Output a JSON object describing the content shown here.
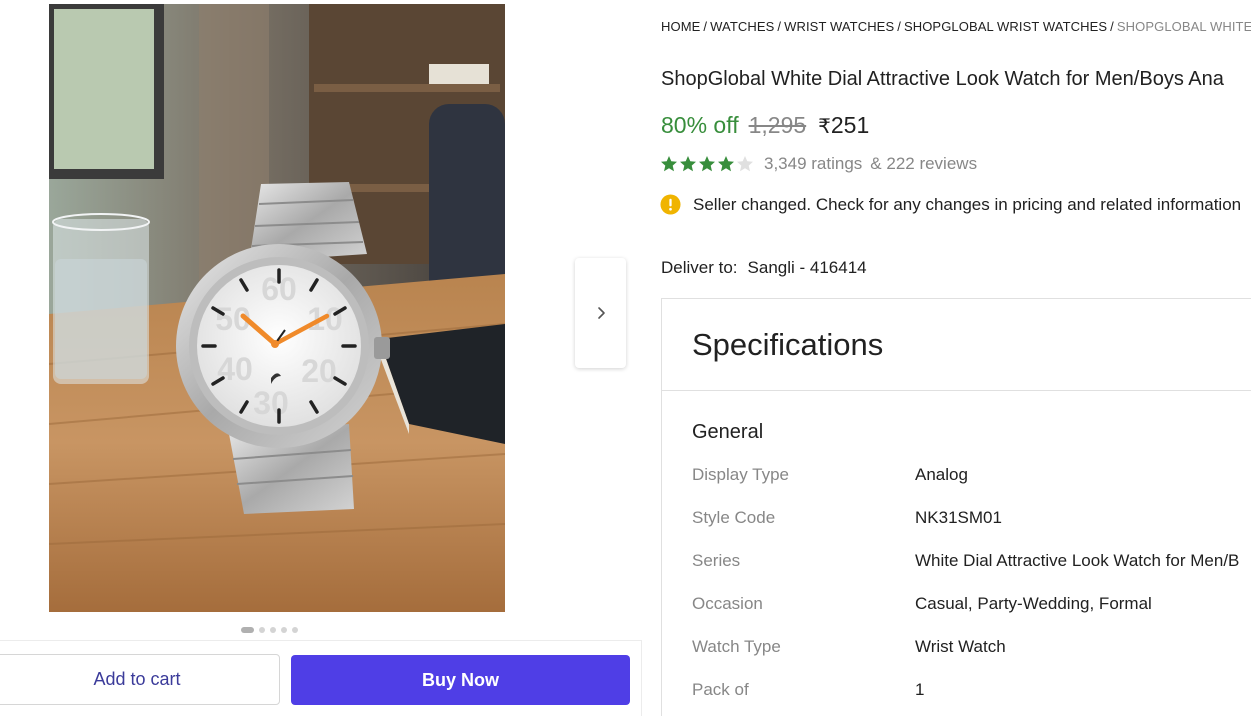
{
  "breadcrumb": [
    {
      "label": "HOME"
    },
    {
      "label": "WATCHES"
    },
    {
      "label": "WRIST WATCHES"
    },
    {
      "label": "SHOPGLOBAL WRIST WATCHES"
    },
    {
      "label": "SHOPGLOBAL WHITE DIA"
    }
  ],
  "product": {
    "title": "ShopGlobal White Dial Attractive Look Watch for Men/Boys Ana",
    "discount": "80% off",
    "mrp": "1,295",
    "currency": "₹",
    "price": "251",
    "rating_stars": 4,
    "ratings": "3,349 ratings",
    "reviews": "& 222 reviews"
  },
  "notice": {
    "text": "Seller changed. Check for any changes in pricing and related information"
  },
  "delivery": {
    "label": "Deliver to:",
    "location": "Sangli - 416414"
  },
  "gallery": {
    "image_count": 5,
    "active_index": 0
  },
  "actions": {
    "add_to_cart": "Add to cart",
    "buy_now": "Buy Now"
  },
  "specifications": {
    "title": "Specifications",
    "group": "General",
    "rows": [
      {
        "key": "Display Type",
        "value": "Analog"
      },
      {
        "key": "Style Code",
        "value": "NK31SM01"
      },
      {
        "key": "Series",
        "value": "White Dial Attractive Look Watch for Men/B"
      },
      {
        "key": "Occasion",
        "value": "Casual, Party-Wedding, Formal"
      },
      {
        "key": "Watch Type",
        "value": "Wrist Watch"
      },
      {
        "key": "Pack of",
        "value": "1"
      }
    ]
  },
  "colors": {
    "discount_green": "#388e3c",
    "star_green": "#388e3c",
    "buy_now_bg": "#4f3ee6",
    "info_icon": "#f0b400",
    "muted_text": "#878787"
  },
  "icons": {
    "next": "chevron-right-icon",
    "info": "info-icon",
    "star": "star-icon"
  }
}
